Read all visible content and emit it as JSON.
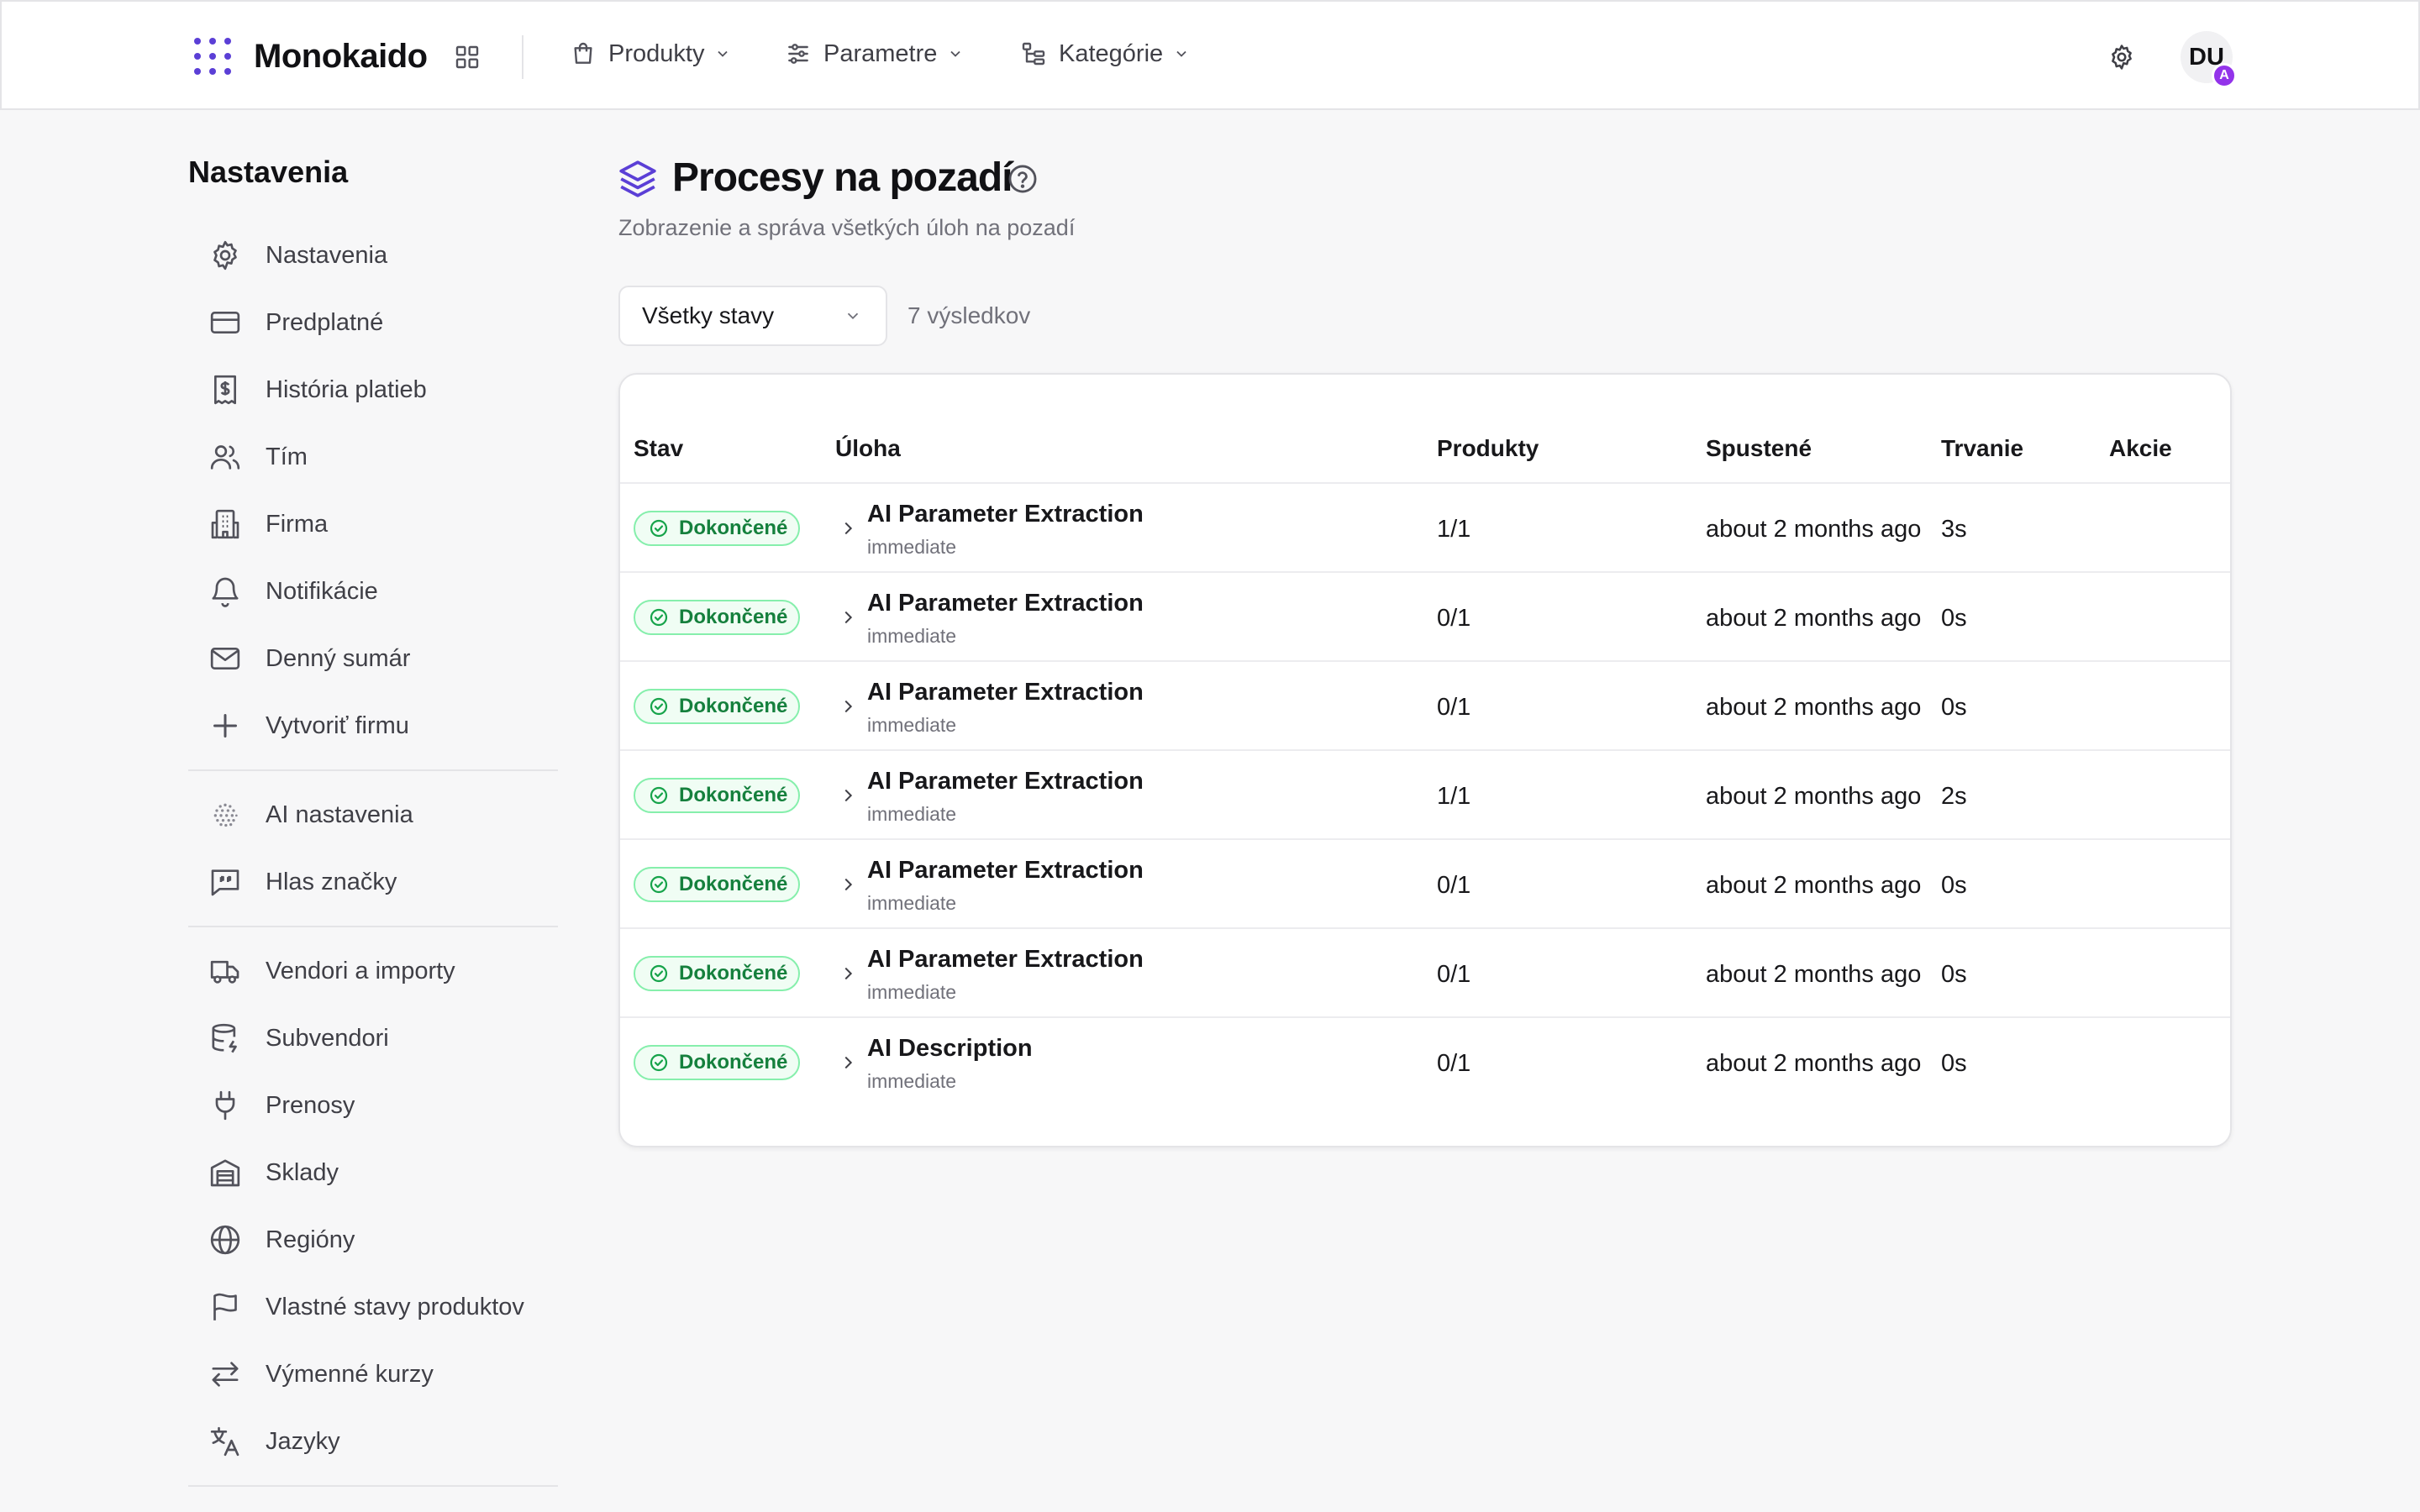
{
  "header": {
    "brand": "Monokaido",
    "nav": [
      {
        "label": "Produkty",
        "icon": "shopping-bag-icon"
      },
      {
        "label": "Parametre",
        "icon": "sliders-icon"
      },
      {
        "label": "Kategórie",
        "icon": "tree-icon"
      }
    ],
    "avatar_initials": "DU",
    "avatar_badge": "A"
  },
  "sidebar": {
    "title": "Nastavenia",
    "groups": [
      [
        {
          "label": "Nastavenia",
          "icon": "gear-icon"
        },
        {
          "label": "Predplatné",
          "icon": "credit-card-icon"
        },
        {
          "label": "História platieb",
          "icon": "receipt-icon"
        },
        {
          "label": "Tím",
          "icon": "users-icon"
        },
        {
          "label": "Firma",
          "icon": "building-icon"
        },
        {
          "label": "Notifikácie",
          "icon": "bell-icon"
        },
        {
          "label": "Denný sumár",
          "icon": "mail-icon"
        },
        {
          "label": "Vytvoriť firmu",
          "icon": "plus-icon"
        }
      ],
      [
        {
          "label": "AI nastavenia",
          "icon": "ai-sphere-icon"
        },
        {
          "label": "Hlas značky",
          "icon": "quote-icon"
        }
      ],
      [
        {
          "label": "Vendori a importy",
          "icon": "truck-icon"
        },
        {
          "label": "Subvendori",
          "icon": "database-icon"
        },
        {
          "label": "Prenosy",
          "icon": "plug-icon"
        },
        {
          "label": "Sklady",
          "icon": "warehouse-icon"
        },
        {
          "label": "Regióny",
          "icon": "globe-icon"
        },
        {
          "label": "Vlastné stavy produktov",
          "icon": "flag-icon"
        },
        {
          "label": "Výmenné kurzy",
          "icon": "exchange-icon"
        },
        {
          "label": "Jazyky",
          "icon": "translate-icon"
        }
      ]
    ]
  },
  "main": {
    "title": "Procesy na pozadí",
    "subtitle": "Zobrazenie a správa všetkých úloh na pozadí",
    "filter_value": "Všetky stavy",
    "result_count": "7 výsledkov",
    "columns": [
      "Stav",
      "Úloha",
      "Produkty",
      "Spustené",
      "Trvanie",
      "Akcie"
    ],
    "rows": [
      {
        "status": "Dokončené",
        "task": "AI Parameter Extraction",
        "type": "immediate",
        "products": "1/1",
        "started": "about 2 months ago",
        "duration": "3s"
      },
      {
        "status": "Dokončené",
        "task": "AI Parameter Extraction",
        "type": "immediate",
        "products": "0/1",
        "started": "about 2 months ago",
        "duration": "0s"
      },
      {
        "status": "Dokončené",
        "task": "AI Parameter Extraction",
        "type": "immediate",
        "products": "0/1",
        "started": "about 2 months ago",
        "duration": "0s"
      },
      {
        "status": "Dokončené",
        "task": "AI Parameter Extraction",
        "type": "immediate",
        "products": "1/1",
        "started": "about 2 months ago",
        "duration": "2s"
      },
      {
        "status": "Dokončené",
        "task": "AI Parameter Extraction",
        "type": "immediate",
        "products": "0/1",
        "started": "about 2 months ago",
        "duration": "0s"
      },
      {
        "status": "Dokončené",
        "task": "AI Parameter Extraction",
        "type": "immediate",
        "products": "0/1",
        "started": "about 2 months ago",
        "duration": "0s"
      },
      {
        "status": "Dokončené",
        "task": "AI Description",
        "type": "immediate",
        "products": "0/1",
        "started": "about 2 months ago",
        "duration": "0s"
      }
    ]
  },
  "colors": {
    "accent": "#5b3fd6",
    "success_text": "#15803d",
    "success_border": "#86efac",
    "success_bg": "#f0fdf4",
    "badge": "#9333ea"
  }
}
